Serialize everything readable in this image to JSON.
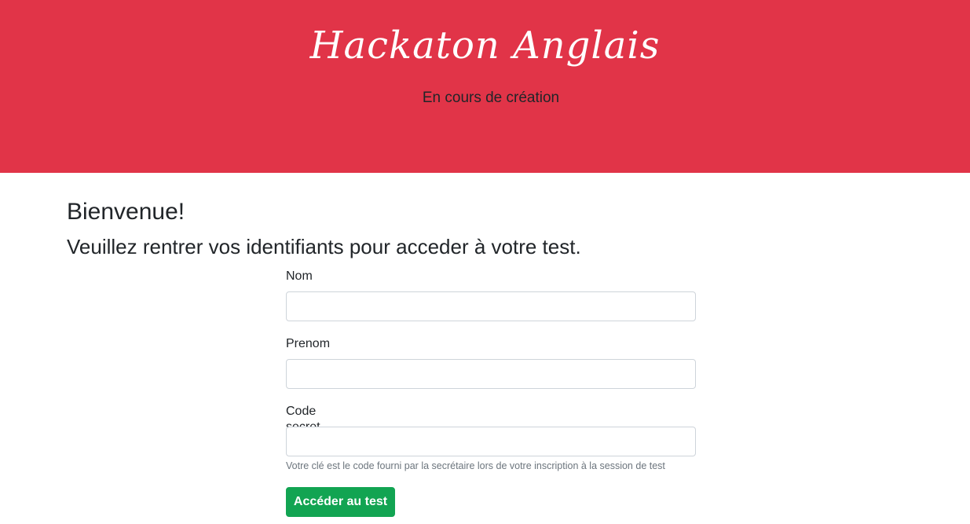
{
  "header": {
    "title": "Hackaton Anglais",
    "subtitle": "En cours de création",
    "background_color": "#e13448"
  },
  "main": {
    "welcome": "Bienvenue!",
    "instruction": "Veuillez rentrer vos identifiants pour acceder à votre test."
  },
  "form": {
    "nom_label": "Nom",
    "nom_value": "",
    "prenom_label": "Prenom",
    "prenom_value": "",
    "code_label": "Code secret",
    "code_value": "",
    "code_help": "Votre clé est le code fourni par la secrétaire lors de votre inscription à la session de test",
    "submit_label": "Accéder au test",
    "submit_color": "#12a452"
  }
}
